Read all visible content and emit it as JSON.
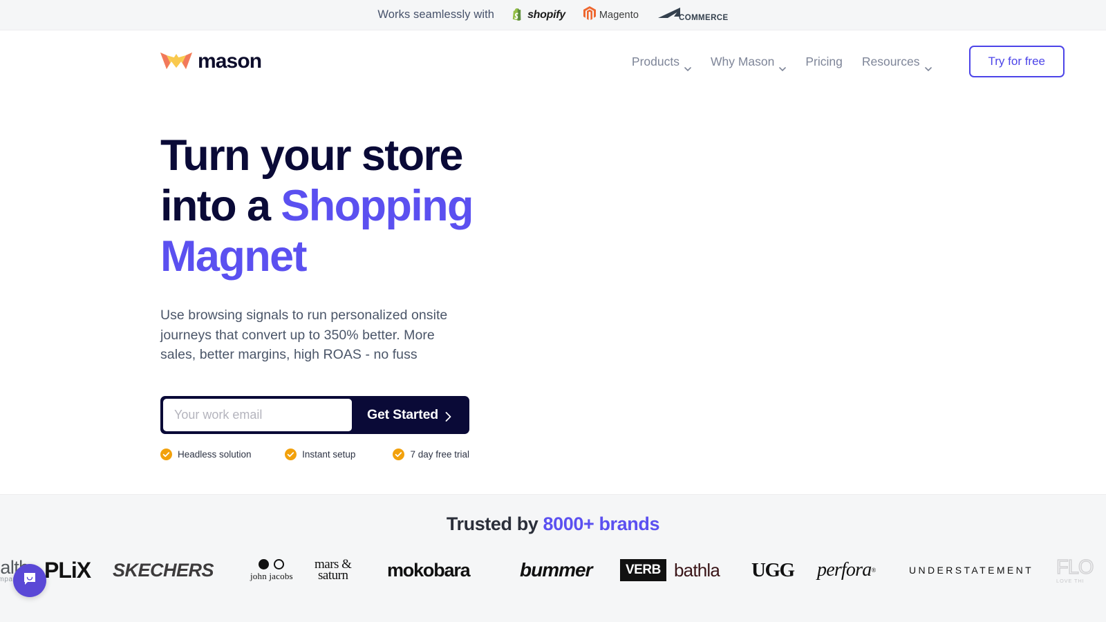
{
  "topbar": {
    "text": "Works seamlessly with",
    "platforms": [
      {
        "name": "shopify",
        "label": "shopify",
        "color": "#95BF47"
      },
      {
        "name": "magento",
        "label": "Magento",
        "color": "#EE672F"
      },
      {
        "name": "bigcommerce",
        "label": "COMMERCE",
        "prefix": "BIG",
        "color": "#34404D"
      }
    ]
  },
  "header": {
    "brand": "mason",
    "nav": [
      {
        "label": "Products",
        "has_dropdown": true
      },
      {
        "label": "Why Mason",
        "has_dropdown": true
      },
      {
        "label": "Pricing",
        "has_dropdown": false
      },
      {
        "label": "Resources",
        "has_dropdown": true
      }
    ],
    "cta_label": "Try for free"
  },
  "hero": {
    "headline_part1": "Turn your store into a ",
    "headline_accent": "Shopping Magnet",
    "subhead": "Use browsing signals to run personalized onsite journeys that convert up to 350% better. More sales, better margins, high ROAS - no fuss",
    "email_placeholder": "Your work email",
    "email_value": "",
    "cta_label": "Get Started",
    "features": [
      {
        "label": "Headless solution"
      },
      {
        "label": "Instant setup"
      },
      {
        "label": "7 day free trial"
      }
    ]
  },
  "trusted": {
    "title_prefix": "Trusted by ",
    "title_accent": "8000+ brands",
    "brands": [
      {
        "name": "health-company",
        "label": "ealth",
        "sublabel": "company"
      },
      {
        "name": "plix",
        "label": "PLiX"
      },
      {
        "name": "skechers",
        "label": "SKECHERS"
      },
      {
        "name": "john-jacobs",
        "label": "john jacobs"
      },
      {
        "name": "mars-and-saturn",
        "label_line1": "mars &",
        "label_line2": "saturn"
      },
      {
        "name": "mokobara",
        "label": "mokobara"
      },
      {
        "name": "bummer",
        "label": "bummer"
      },
      {
        "name": "verb",
        "label": "VERB"
      },
      {
        "name": "bathla",
        "label": "bathla"
      },
      {
        "name": "ugg",
        "label": "UGG"
      },
      {
        "name": "perfora",
        "label": "perfora"
      },
      {
        "name": "understatement",
        "label": "UNDERSTATEMENT"
      },
      {
        "name": "flo",
        "label": "FLO",
        "sublabel": "LOVE THI"
      }
    ]
  },
  "chat": {
    "icon": "chat-bubble-icon"
  },
  "colors": {
    "accent_indigo": "#5B50F0",
    "navy": "#0A0A37",
    "check_orange": "#F2A10C",
    "chat_purple": "#5A48D6",
    "section_bg": "#F5F6F7"
  }
}
